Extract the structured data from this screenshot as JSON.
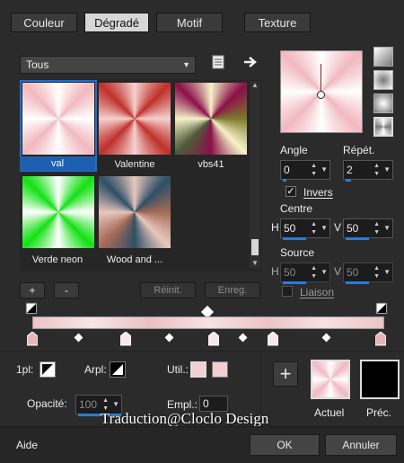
{
  "tabs": [
    {
      "label": "Couleur"
    },
    {
      "label": "Dégradé"
    },
    {
      "label": "Motif"
    },
    {
      "label": "Texture"
    }
  ],
  "active_tab": "Dégradé",
  "filter": {
    "selected": "Tous"
  },
  "gallery": {
    "items": [
      {
        "label": "val",
        "selected": true
      },
      {
        "label": "Valentine"
      },
      {
        "label": "vbs41"
      },
      {
        "label": "Verde neon"
      },
      {
        "label": "Wood and ..."
      }
    ]
  },
  "settings": {
    "angle_label": "Angle",
    "angle_value": "0",
    "repeat_label": "Répét.",
    "repeat_value": "2",
    "invert_label": "Invers",
    "invert_checked": true,
    "center_label": "Centre",
    "center_h_label": "H",
    "center_h_value": "50",
    "center_v_label": "V",
    "center_v_value": "50",
    "focal_label": "Source",
    "focal_h_label": "H",
    "focal_h_value": "50",
    "focal_v_label": "V",
    "focal_v_value": "50",
    "link_label": "Liaison"
  },
  "gallery_buttons": {
    "add": "+",
    "remove": "-",
    "reset": "Réinit.",
    "save": "Enreg."
  },
  "bottom": {
    "left_label": "1pl:",
    "right_label": "Arpl:",
    "use_label": "Util.:",
    "opacity_label": "Opacité:",
    "opacity_value": "100",
    "location_label": "Empl.:",
    "location_value": "0",
    "current_label": "Actuel",
    "previous_label": "Préc."
  },
  "watermark": "Traduction@Cloclo Design",
  "footer": {
    "help": "Aide",
    "ok": "OK",
    "cancel": "Annuler"
  },
  "colors": {
    "accent": "#2b7bd6",
    "pink": "#f4cfd2",
    "black_swatch": "#000000"
  }
}
